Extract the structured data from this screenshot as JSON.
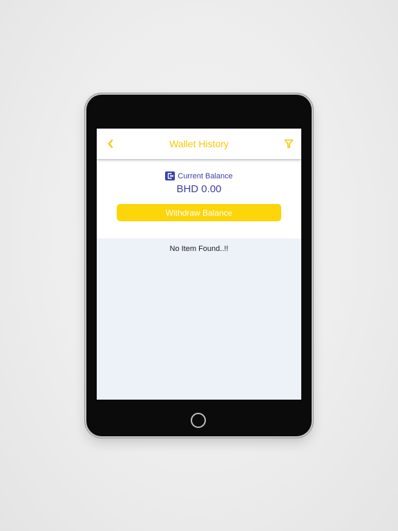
{
  "header": {
    "title": "Wallet History",
    "back_icon": "chevron-left-icon",
    "filter_icon": "filter-icon"
  },
  "balance": {
    "label": "Current Balance",
    "amount": "BHD 0.00",
    "icon": "wallet-icon"
  },
  "actions": {
    "withdraw_label": "Withdraw Balance"
  },
  "history": {
    "empty_message": "No Item Found..!!"
  },
  "colors": {
    "accent_yellow": "#fcd50a",
    "title_yellow": "#f6c800",
    "brand_indigo": "#3b3fa6",
    "content_background": "#edf1f8"
  }
}
